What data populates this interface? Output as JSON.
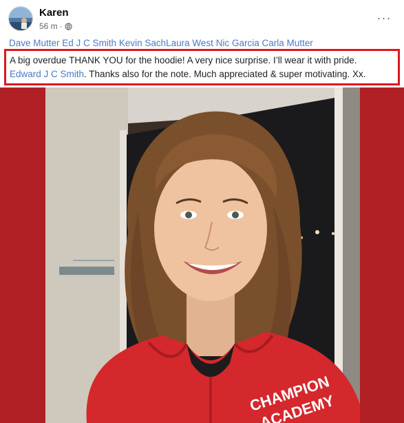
{
  "post": {
    "author": "Karen",
    "time": "56 m",
    "separator": "·",
    "audience_icon": "globe-icon",
    "more_icon": "more-options-icon",
    "more_label": "···"
  },
  "tags": [
    {
      "name": "Dave Mutter",
      "sep": " "
    },
    {
      "name": "Ed J C Smith",
      "sep": " "
    },
    {
      "name": "Kevin Sach",
      "sep": ""
    },
    {
      "name": "Laura West",
      "sep": " "
    },
    {
      "name": "Nic Garcia",
      "sep": " "
    },
    {
      "name": "Carla Mutter",
      "sep": ""
    }
  ],
  "message": {
    "line1": "A big overdue THANK YOU for the hoodie!  A very nice surprise. I’ll wear it with pride.",
    "mention": "Edward J C Smith",
    "line2": ". Thanks also for the note. Much appreciated & super motivating.  Xx."
  },
  "photo": {
    "hoodie_text_1": "CHAMPION",
    "hoodie_text_2": "ACADEMY"
  },
  "colors": {
    "link": "#4a79c4",
    "highlight_border": "#e1141b",
    "photo_background": "#b01f24",
    "hoodie": "#d4282c"
  }
}
